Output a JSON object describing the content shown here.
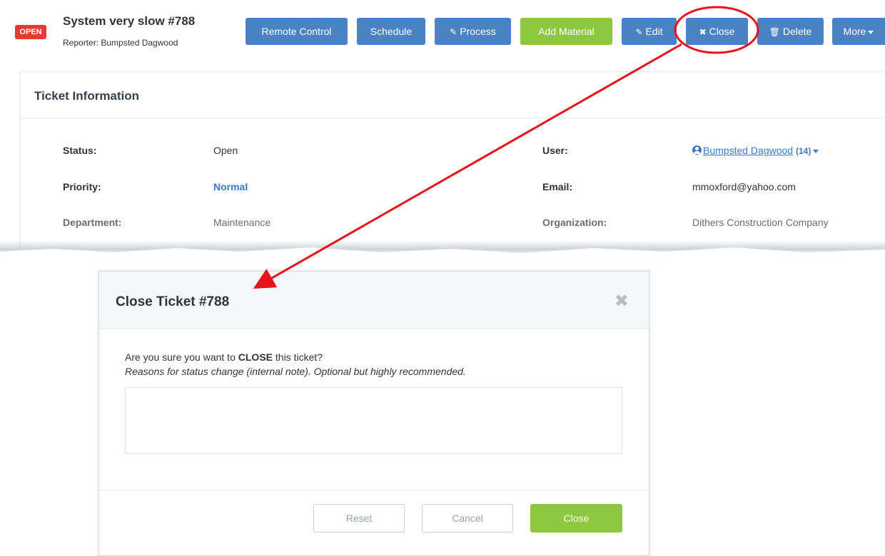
{
  "header": {
    "status_badge": "OPEN",
    "title": "System very slow #788",
    "reporter": "Reporter: Bumpsted Dagwood",
    "buttons": {
      "remote_control": "Remote Control",
      "schedule": "Schedule",
      "process": "Process",
      "add_material": "Add Material",
      "edit": "Edit",
      "close": "Close",
      "delete": "Delete",
      "more": "More"
    }
  },
  "ticket_info": {
    "title": "Ticket Information",
    "status_label": "Status:",
    "status_value": "Open",
    "priority_label": "Priority:",
    "priority_value": "Normal",
    "department_label": "Department:",
    "department_value": "Maintenance",
    "user_label": "User:",
    "user_value": "Bumpsted Dagwood",
    "user_count": "(14)",
    "email_label": "Email:",
    "email_value": "mmoxford@yahoo.com",
    "organization_label": "Organization:",
    "organization_value": "Dithers Construction Company"
  },
  "modal": {
    "title": "Close Ticket #788",
    "question_prefix": "Are you sure you want to ",
    "question_action": "CLOSE",
    "question_suffix": " this ticket?",
    "note": "Reasons for status change (internal note). Optional but highly recommended.",
    "reason_value": "",
    "reset_button": "Reset",
    "cancel_button": "Cancel",
    "close_button": "Close"
  },
  "colors": {
    "primary_blue": "#4a82c3",
    "green": "#8dc63f",
    "badge_red": "#e53935",
    "annotation_red": "#e8121b"
  }
}
